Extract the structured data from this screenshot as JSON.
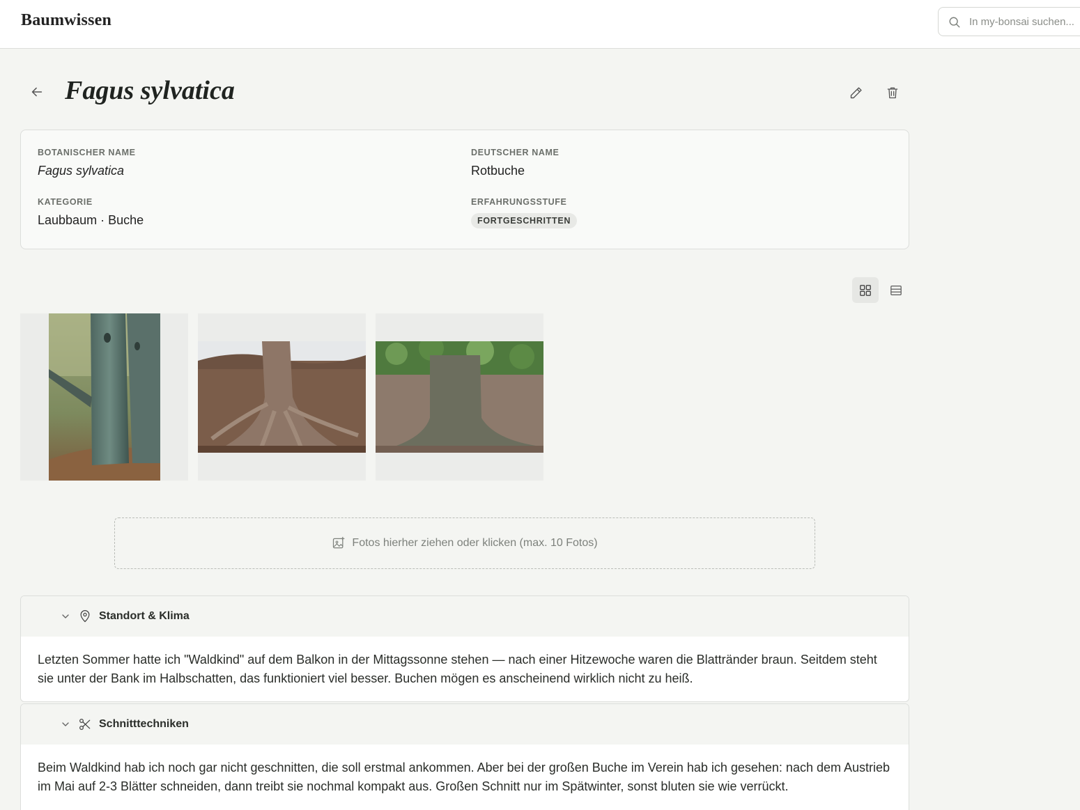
{
  "header": {
    "brand": "Baumwissen",
    "search_placeholder": "In my-bonsai suchen..."
  },
  "page": {
    "title": "Fagus sylvatica"
  },
  "info": {
    "botanical_label": "Botanischer Name",
    "botanical_value": "Fagus sylvatica",
    "german_label": "Deutscher Name",
    "german_value": "Rotbuche",
    "category_label": "Kategorie",
    "category_value": "Laubbaum · Buche",
    "experience_label": "Erfahrungsstufe",
    "experience_value": "FORTGESCHRITTEN"
  },
  "upload": {
    "label": "Fotos hierher ziehen oder klicken (max. 10 Fotos)"
  },
  "sections": [
    {
      "title": "Standort & Klima",
      "icon": "map-pin-icon",
      "text": "Letzten Sommer hatte ich \"Waldkind\" auf dem Balkon in der Mittagssonne stehen — nach einer Hitzewoche waren die Blattränder braun. Seitdem steht sie unter der Bank im Halbschatten, das funktioniert viel besser. Buchen mögen es anscheinend wirklich nicht zu heiß."
    },
    {
      "title": "Schnitttechniken",
      "icon": "scissors-icon",
      "text": "Beim Waldkind hab ich noch gar nicht geschnitten, die soll erstmal ankommen. Aber bei der großen Buche im Verein hab ich gesehen: nach dem Austrieb im Mai auf 2-3 Blätter schneiden, dann treibt sie nochmal kompakt aus. Großen Schnitt nur im Spätwinter, sonst bluten sie wie verrückt."
    }
  ],
  "colors": {
    "background": "#f4f5f2",
    "card": "#f9faf8",
    "border": "#dcdedb",
    "muted_text": "#6b6f6a"
  }
}
